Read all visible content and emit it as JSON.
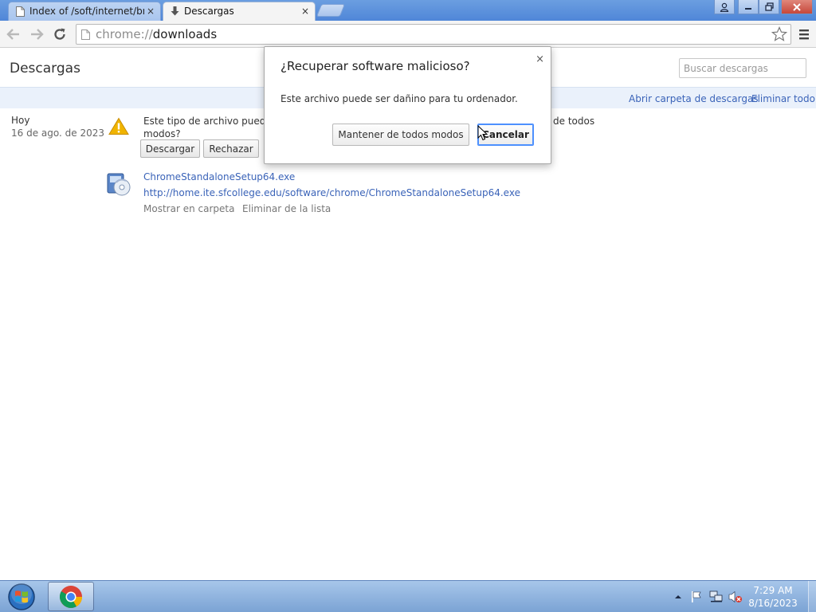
{
  "tabs": [
    {
      "title": "Index of /soft/internet/bro",
      "close": "×",
      "icon": "document-icon"
    },
    {
      "title": "Descargas",
      "close": "×",
      "icon": "download-arrow-icon"
    }
  ],
  "window_controls": {
    "user": "person-icon",
    "minimize": "minimize-icon",
    "restore": "restore-icon",
    "close": "close-icon"
  },
  "toolbar": {
    "url_scheme": "chrome://",
    "url_host": "downloads"
  },
  "page": {
    "title": "Descargas",
    "search_placeholder": "Buscar descargas",
    "open_folder": "Abrir carpeta de descargas",
    "clear_all": "Eliminar todo"
  },
  "download": {
    "date_label": "Hoy",
    "date_full": "16 de ago. de 2023",
    "warning_text": "Este tipo de archivo puede d",
    "warning_text_tail": "de todos",
    "warning_text_line2": "modos?",
    "download_button": "Descargar",
    "reject_button": "Rechazar",
    "file_name": "ChromeStandaloneSetup64.exe",
    "file_url": "http://home.ite.sfcollege.edu/software/chrome/ChromeStandaloneSetup64.exe",
    "show_in_folder": "Mostrar en carpeta",
    "remove_from_list": "Eliminar de la lista"
  },
  "dialog": {
    "title": "¿Recuperar software malicioso?",
    "message": "Este archivo puede ser dañino para tu ordenador.",
    "keep_button": "Mantener de todos modos",
    "cancel_button": "Cancelar",
    "close": "×"
  },
  "taskbar": {
    "time": "7:29 AM",
    "date": "8/16/2023"
  },
  "colors": {
    "link": "#3a63b8",
    "focus_ring": "#4d90fe",
    "warning": "#f0b400",
    "tab_strip": "#4f86d8"
  }
}
